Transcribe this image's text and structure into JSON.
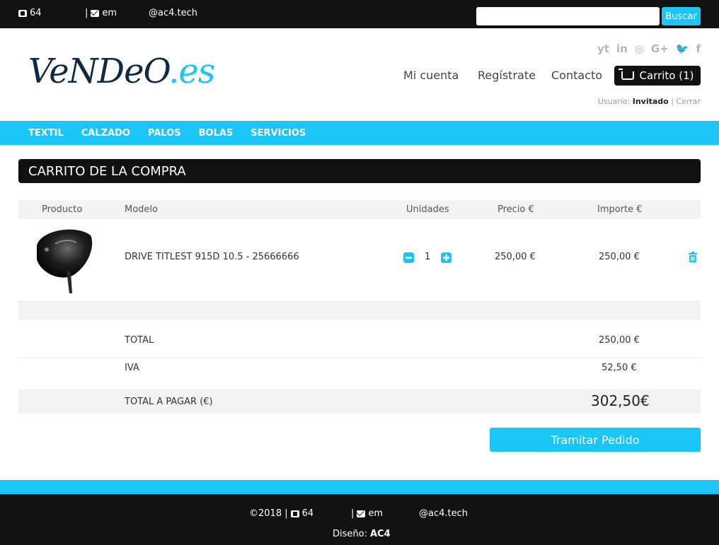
{
  "topbar": {
    "phone": "64",
    "email_prefix": "| ",
    "email": "em",
    "domain": "@ac4.tech",
    "search_placeholder": "",
    "search_button": "Buscar"
  },
  "header": {
    "logo_main": "VeNDeO",
    "logo_ext": ".es",
    "social": [
      "yt",
      "in",
      "◎",
      "G+",
      "🐦",
      "f"
    ],
    "nav": {
      "account": "Mi cuenta",
      "register": "Regístrate",
      "contact": "Contacto"
    },
    "cart_label": "Carrito (1)",
    "user_prefix": "Usuario: ",
    "user_name": "Invitado",
    "user_sep": " | ",
    "logout": "Cerrar"
  },
  "category_nav": [
    "TEXTIL",
    "CALZADO",
    "PALOS",
    "BOLAS",
    "SERVICIOS"
  ],
  "page_title": "CARRITO DE LA COMPRA",
  "table": {
    "headers": {
      "product": "Producto",
      "model": "Modelo",
      "units": "Unidades",
      "price": "Precio €",
      "amount": "Importe €"
    },
    "items": [
      {
        "model": "DRIVE TITLEST 915D 10.5 - 25666666",
        "quantity": "1",
        "price": "250,00 €",
        "amount": "250,00 €"
      }
    ]
  },
  "totals": {
    "total_label": "TOTAL",
    "total_value": "250,00 €",
    "iva_label": "IVA",
    "iva_value": "52,50 €",
    "pay_label": "TOTAL A PAGAR (€)",
    "pay_value": "302,50€"
  },
  "checkout_button": "Tramitar Pedido",
  "footer": {
    "copyright": "©2018 |",
    "phone": "64",
    "email_prefix": "| ",
    "email": "em",
    "domain": "@ac4.tech",
    "design_label": "Diseño: ",
    "design_value": "AC4"
  },
  "colors": {
    "accent": "#1ac6f5",
    "dark": "#111111",
    "band": "#f3f3f3"
  }
}
